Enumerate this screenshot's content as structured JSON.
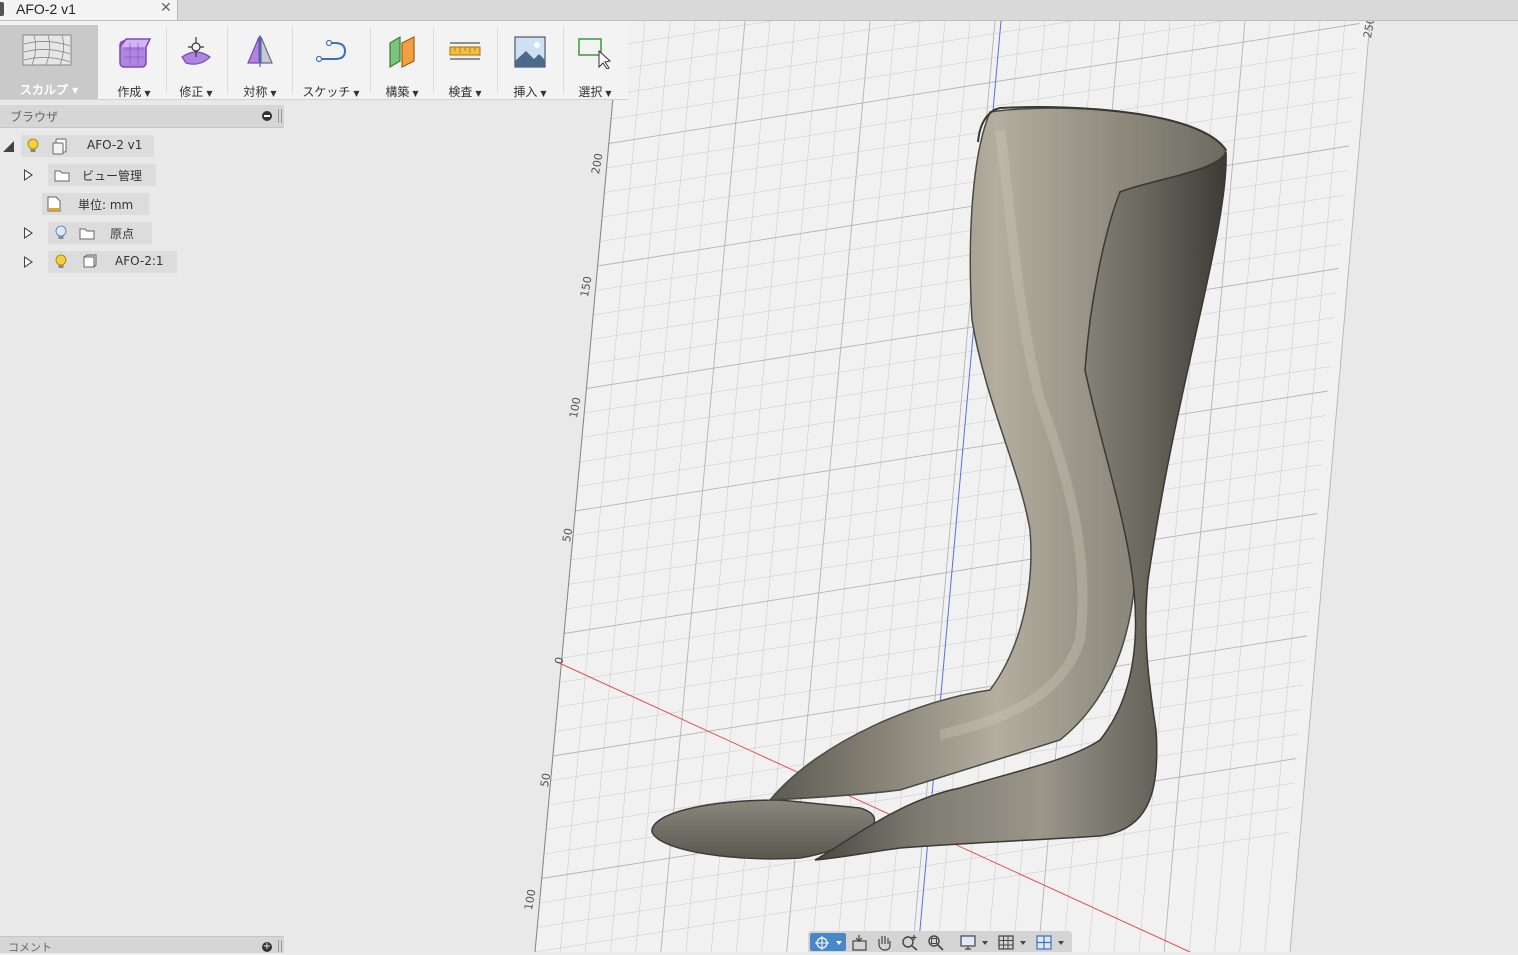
{
  "tab": {
    "title": "AFO-2 v1",
    "close": "✕"
  },
  "toolbar": {
    "workspace": "スカルプ ▾",
    "tools": [
      {
        "label": "作成",
        "icon": "create-box-icon"
      },
      {
        "label": "修正",
        "icon": "modify-icon"
      },
      {
        "label": "対称",
        "icon": "symmetry-icon"
      },
      {
        "label": "スケッチ",
        "icon": "sketch-icon"
      },
      {
        "label": "構築",
        "icon": "construct-icon"
      },
      {
        "label": "検査",
        "icon": "inspect-icon"
      },
      {
        "label": "挿入",
        "icon": "insert-image-icon"
      },
      {
        "label": "選択",
        "icon": "select-icon"
      }
    ],
    "dropdown_arrow": "▼"
  },
  "browser": {
    "title": "ブラウザ",
    "nodes": [
      {
        "label": "AFO-2 v1"
      },
      {
        "label": "ビュー管理"
      },
      {
        "label": "単位: mm"
      },
      {
        "label": "原点"
      },
      {
        "label": "AFO-2:1"
      }
    ]
  },
  "comments": {
    "title": "コメント",
    "add": "+"
  },
  "viewport": {
    "ruler_labels": [
      "200",
      "150",
      "100",
      "50",
      "0",
      "50",
      "100"
    ],
    "corner_label": "250",
    "colors": {
      "x_axis": "#e05050",
      "z_axis": "#5a6ee0",
      "grid": "#c8c8c8",
      "model": "#6f6c62"
    }
  },
  "navbar": {
    "icons": [
      "orbit-icon",
      "look-at-icon",
      "pan-icon",
      "zoom-icon",
      "fit-icon",
      "display-settings-icon",
      "grid-settings-icon",
      "viewports-icon"
    ]
  }
}
